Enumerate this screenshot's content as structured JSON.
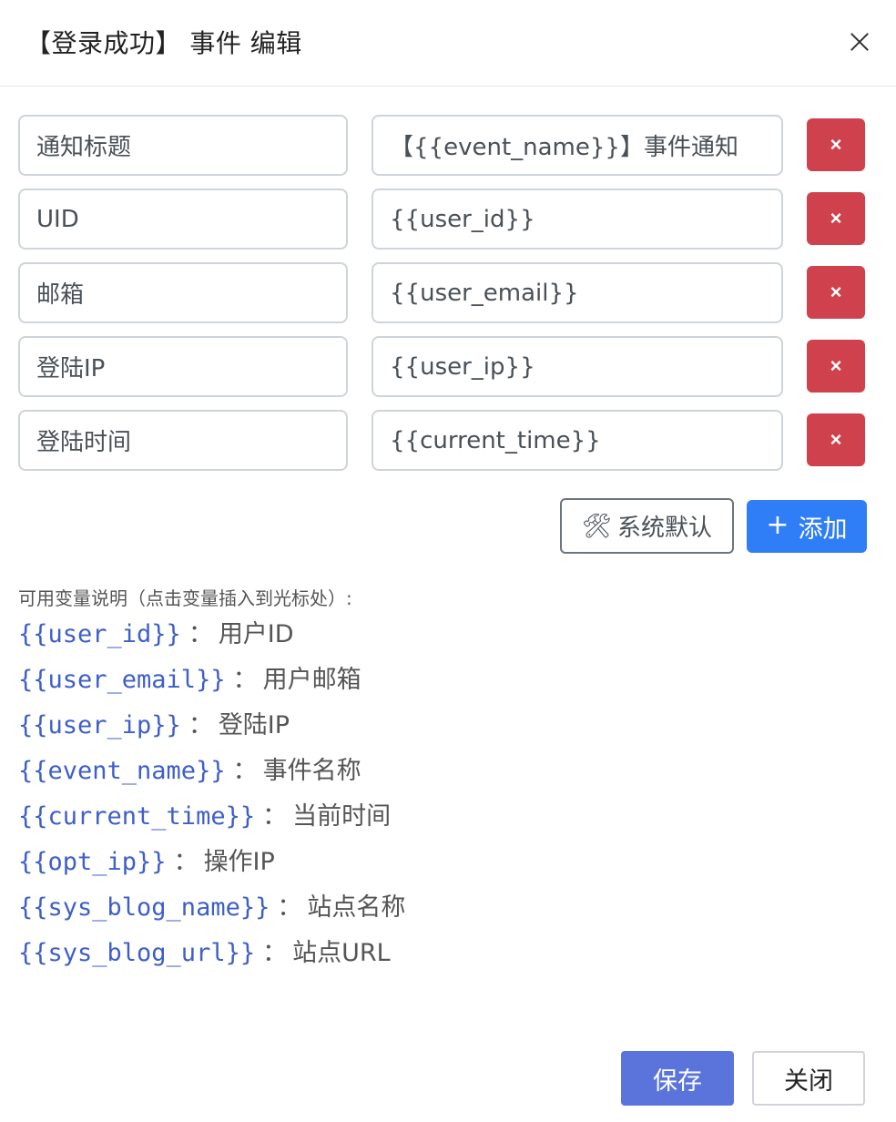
{
  "dialog": {
    "title": "【登录成功】 事件 编辑",
    "close_icon": "close-icon"
  },
  "rows": [
    {
      "key": "通知标题",
      "value": "【{{event_name}}】事件通知",
      "delete_label": "×"
    },
    {
      "key": "UID",
      "value": "{{user_id}}",
      "delete_label": "×"
    },
    {
      "key": "邮箱",
      "value": "{{user_email}}",
      "delete_label": "×"
    },
    {
      "key": "登陆IP",
      "value": "{{user_ip}}",
      "delete_label": "×"
    },
    {
      "key": "登陆时间",
      "value": "{{current_time}}",
      "delete_label": "×"
    }
  ],
  "actions": {
    "default_icon": "🛠",
    "default_label": "系统默认",
    "add_icon": "+",
    "add_label": "添加"
  },
  "help": {
    "title": "可用变量说明（点击变量插入到光标处）:",
    "separator": "：",
    "variables": [
      {
        "code": "{{user_id}}",
        "desc": "用户ID"
      },
      {
        "code": "{{user_email}}",
        "desc": "用户邮箱"
      },
      {
        "code": "{{user_ip}}",
        "desc": "登陆IP"
      },
      {
        "code": "{{event_name}}",
        "desc": "事件名称"
      },
      {
        "code": "{{current_time}}",
        "desc": "当前时间"
      },
      {
        "code": "{{opt_ip}}",
        "desc": "操作IP"
      },
      {
        "code": "{{sys_blog_name}}",
        "desc": "站点名称"
      },
      {
        "code": "{{sys_blog_url}}",
        "desc": "站点URL"
      }
    ]
  },
  "footer": {
    "save_label": "保存",
    "close_label": "关闭"
  },
  "colors": {
    "delete": "#cf424d",
    "add": "#2f7ef7",
    "save": "#5a74dc",
    "variable": "#3e5fc9"
  }
}
